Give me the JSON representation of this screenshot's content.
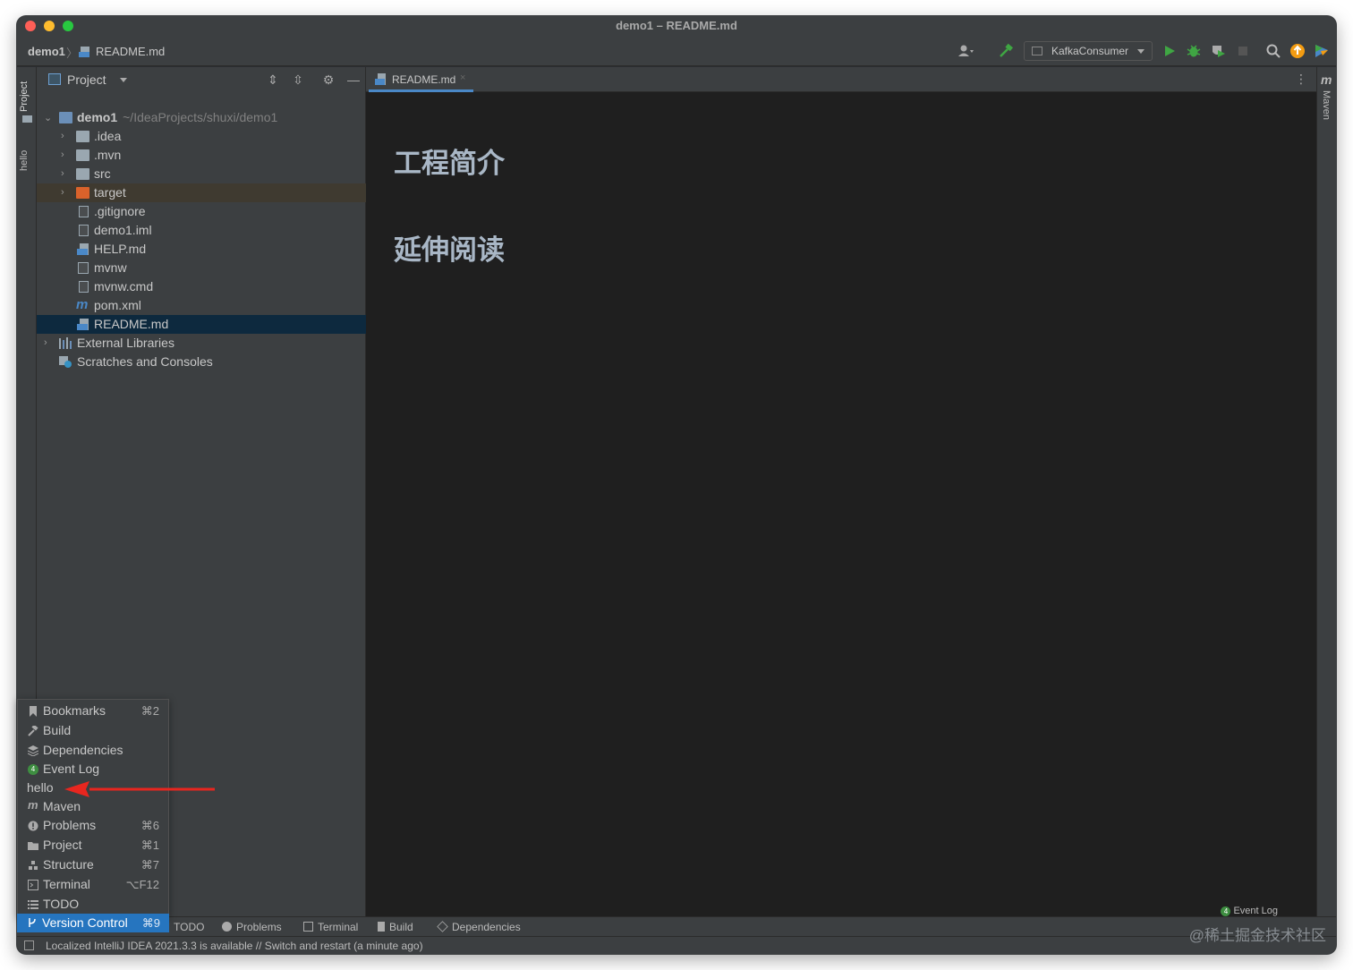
{
  "window": {
    "title": "demo1 – README.md"
  },
  "navbar": {
    "breadcrumb_root": "demo1",
    "breadcrumb_separator": "〉",
    "breadcrumb_file": "README.md",
    "run_config": "KafkaConsumer"
  },
  "left_strip": {
    "project_tab": "Project",
    "hello_tab": "hello"
  },
  "right_strip": {
    "maven_tab": "Maven",
    "maven_icon_text": "m"
  },
  "project_panel": {
    "title": "Project",
    "tree": [
      {
        "label": "demo1",
        "path": "~/IdeaProjects/shuxi/demo1",
        "icon": "module-folder-icon",
        "expanded": true
      },
      {
        "label": ".idea",
        "icon": "folder-icon"
      },
      {
        "label": ".mvn",
        "icon": "folder-icon"
      },
      {
        "label": "src",
        "icon": "folder-icon"
      },
      {
        "label": "target",
        "icon": "excluded-folder-icon"
      },
      {
        "label": ".gitignore",
        "icon": "gitignore-file-icon"
      },
      {
        "label": "demo1.iml",
        "icon": "iml-file-icon"
      },
      {
        "label": "HELP.md",
        "icon": "markdown-file-icon"
      },
      {
        "label": "mvnw",
        "icon": "script-file-icon"
      },
      {
        "label": "mvnw.cmd",
        "icon": "cmd-file-icon"
      },
      {
        "label": "pom.xml",
        "icon": "maven-file-icon"
      },
      {
        "label": "README.md",
        "icon": "markdown-file-icon",
        "selected": true
      },
      {
        "label": "External Libraries",
        "icon": "libraries-icon"
      },
      {
        "label": "Scratches and Consoles",
        "icon": "scratches-icon"
      }
    ]
  },
  "editor": {
    "tab_label": "README.md",
    "tab_close": "×",
    "headings": [
      "工程简介",
      "延伸阅读"
    ]
  },
  "popup_menu": {
    "items": [
      {
        "label": "Bookmarks",
        "shortcut": "⌘2",
        "icon": "bookmark-icon"
      },
      {
        "label": "Build",
        "shortcut": "",
        "icon": "hammer-icon"
      },
      {
        "label": "Dependencies",
        "shortcut": "",
        "icon": "layers-icon"
      },
      {
        "label": "Event Log",
        "shortcut": "",
        "icon": "event-log-icon",
        "badge": "4"
      },
      {
        "label": "hello",
        "shortcut": "",
        "icon": ""
      },
      {
        "label": "Maven",
        "shortcut": "",
        "icon": "maven-icon"
      },
      {
        "label": "Problems",
        "shortcut": "⌘6",
        "icon": "problems-icon"
      },
      {
        "label": "Project",
        "shortcut": "⌘1",
        "icon": "folder-icon"
      },
      {
        "label": "Structure",
        "shortcut": "⌘7",
        "icon": "structure-icon"
      },
      {
        "label": "Terminal",
        "shortcut": "⌥F12",
        "icon": "terminal-icon"
      },
      {
        "label": "TODO",
        "shortcut": "",
        "icon": "todo-icon"
      },
      {
        "label": "Version Control",
        "shortcut": "⌘9",
        "icon": "vcs-icon",
        "selected": true
      }
    ]
  },
  "bottom_toolbar": {
    "items": [
      "TODO",
      "Problems",
      "Terminal",
      "Build",
      "Dependencies"
    ],
    "event_log": "Event Log",
    "event_log_badge": "4"
  },
  "statusbar": {
    "message": "Localized IntelliJ IDEA 2021.3.3 is available // Switch and restart (a minute ago)"
  },
  "watermark": "@稀土掘金技术社区",
  "colors": {
    "selection": "#2675bf",
    "tree_selected": "#0d293e",
    "tab_underline": "#4a88c7",
    "annotation_arrow": "#e8261f",
    "run_green": "#3fa643",
    "update_orange": "#f39c12"
  }
}
